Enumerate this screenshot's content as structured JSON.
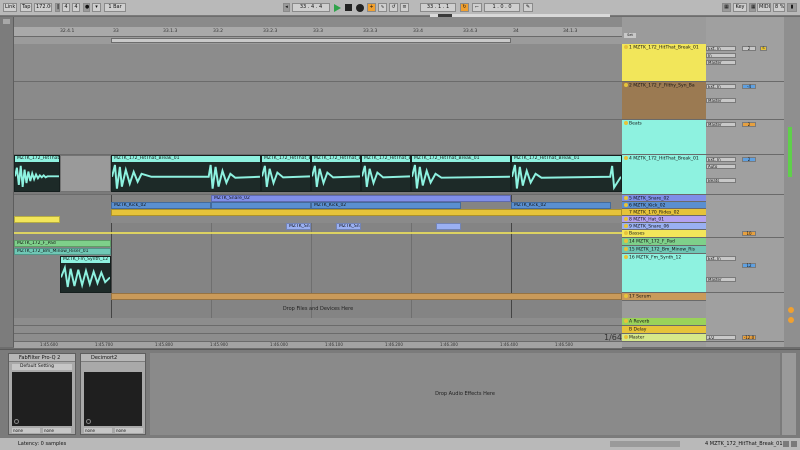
{
  "transport": {
    "link_label": "Link",
    "tap_label": "Tap",
    "tempo": "172.00",
    "time_sig_num": "4",
    "time_sig_den": "4",
    "quant_label": "1 Bar",
    "position": "33 .   4 .   4",
    "loop_start": "33 .   1 .   1",
    "loop_length": "1 .   0 .   0",
    "key_label": "Key",
    "midi_label": "MIDI",
    "cpu_label": "8 %"
  },
  "ruler": {
    "bars": [
      "32.4.1",
      "33",
      "33.1.3",
      "33.2",
      "33.2.3",
      "33.3",
      "33.3.3",
      "33.4",
      "33.4.3",
      "34",
      "34.1.3"
    ],
    "times": [
      "1:45.600",
      "1:45.700",
      "1:45.800",
      "1:45.900",
      "1:46.000",
      "1:46.100",
      "1:46.200",
      "1:46.300",
      "1:46.400",
      "1:46.500"
    ]
  },
  "page_indicator": "1/64",
  "drop_files_label": "Drop Files and Devices Here",
  "tracks": [
    {
      "name": "1 MZTK_172_HitThat_Break_01",
      "color": "#f2e65a"
    },
    {
      "name": "2 MZTK_172_F_Filthy_Syn_Ba",
      "color": "#9b7a52"
    },
    {
      "name": "Beats",
      "color": "#8ef2e0"
    },
    {
      "name": "4 MZTK_172_HitThat_Break_01",
      "color": "#8ef2e0"
    },
    {
      "name": "5 MZTK_Snare_02",
      "color": "#7f8ee8"
    },
    {
      "name": "6 MZTK_Kick_02",
      "color": "#5a8fd0"
    },
    {
      "name": "7 MZTK_170_Rides_02",
      "color": "#e6c33a"
    },
    {
      "name": "8 MZTK_Hat_01",
      "color": "#b4a2f0"
    },
    {
      "name": "9 MZTK_Snare_06",
      "color": "#9ab0f2"
    },
    {
      "name": "Basses",
      "color": "#f2e65a"
    },
    {
      "name": "14 MZTK_172_F_Pad",
      "color": "#7ed08a"
    },
    {
      "name": "15 MZTK_172_Bm_Minow_Ris",
      "color": "#6fc7b5"
    },
    {
      "name": "16 MZTK_Fm_Synth_12",
      "color": "#8ef2e0"
    },
    {
      "name": "17 Serum",
      "color": "#c99a5a"
    },
    {
      "name": "A Reverb",
      "color": "#9ad25a"
    },
    {
      "name": "B Delay",
      "color": "#e6c33a"
    },
    {
      "name": "Master",
      "color": "#d6e88a"
    }
  ],
  "clips": {
    "break_label": "MZTK_172_HitThat_",
    "break_full": "MZTK_172_HitThat_Break_01",
    "break_short": "MZTK_172_HitThat_Brea",
    "snare02": "MZTK_Snare_02",
    "kick02": "MZTK_Kick_02",
    "snare06_short": "MZTK_Snar",
    "pad": "MZTK_172_F_Pad",
    "riser": "MZTK_172_Bm_Minow_Riser_01",
    "fm_synth": "MZTK_Fm_Synth_12"
  },
  "mixer": {
    "ext_in": "Ext. In",
    "master": "Master",
    "beats": "Beats",
    "in_label": "In",
    "auto_label": "Auto",
    "off_label": "Off",
    "vol_4": "-4",
    "vol_2": "2",
    "vol_12": "12",
    "vol_10": "10",
    "vol_20": "-12.0",
    "master_ratio": "1/2"
  },
  "devices": {
    "fabfilter_title": "FabFilter Pro-Q 2",
    "fabfilter_preset": "Default Setting",
    "decimort_title": "Decimort2",
    "none_label": "none",
    "drop_effects_label": "Drop Audio Effects Here"
  },
  "status": {
    "latency": "Latency: 0 samples",
    "selected_track": "4 MZTK_172_HitThat_Break_01"
  }
}
